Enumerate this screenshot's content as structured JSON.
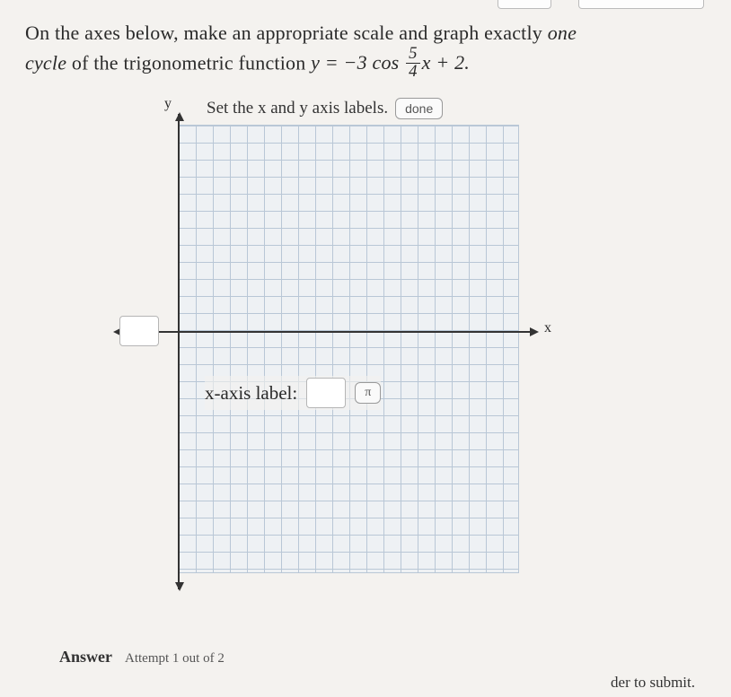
{
  "question": {
    "line1_a": "On the axes below, make an appropriate scale and graph exactly ",
    "line1_em": "one",
    "line2_a": "cycle",
    "line2_b": " of the trigonometric function ",
    "eq_lhs": "y = −3 cos ",
    "eq_frac_num": "5",
    "eq_frac_den": "4",
    "eq_rhs": "x + 2."
  },
  "graph": {
    "instruction": "Set the x and y axis labels.",
    "done_label": "done",
    "y_label": "y",
    "x_label": "x",
    "x_axis_prompt": "x-axis label:",
    "pi_label": "π"
  },
  "answer": {
    "heading": "Answer",
    "attempt": "Attempt 1 out of 2"
  },
  "frag": {
    "submit": "der to submit."
  }
}
